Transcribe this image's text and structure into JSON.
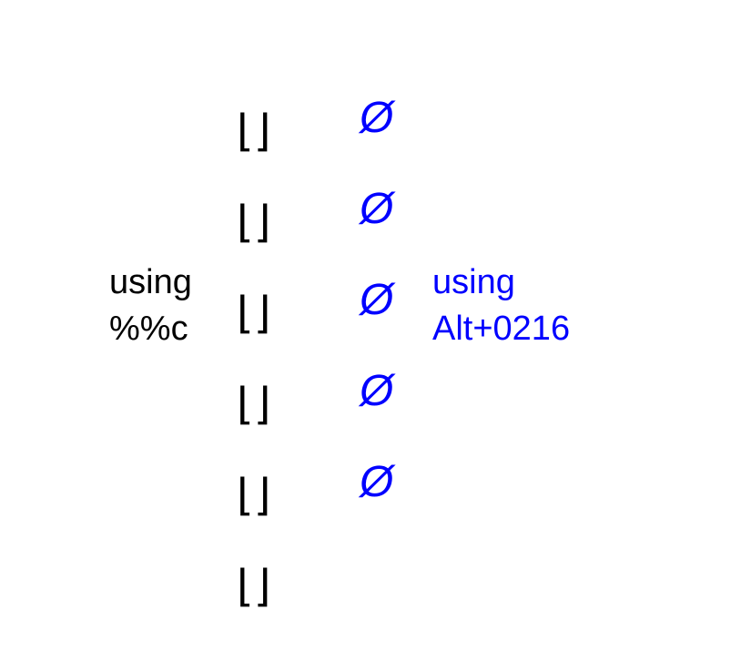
{
  "left_label_line1": "using",
  "left_label_line2": "%%c",
  "right_label_line1": "using",
  "right_label_line2": "Alt+0216",
  "col_a": {
    "g0": "⌊⌋",
    "g1": "⌊⌋",
    "g2": "⌊⌋",
    "g3": "⌊⌋",
    "g4": "⌊⌋",
    "g5": "⌊⌋"
  },
  "col_b": {
    "g0": "Ø",
    "g1": "Ø",
    "g2": "Ø",
    "g3": "Ø",
    "g4": "Ø"
  }
}
